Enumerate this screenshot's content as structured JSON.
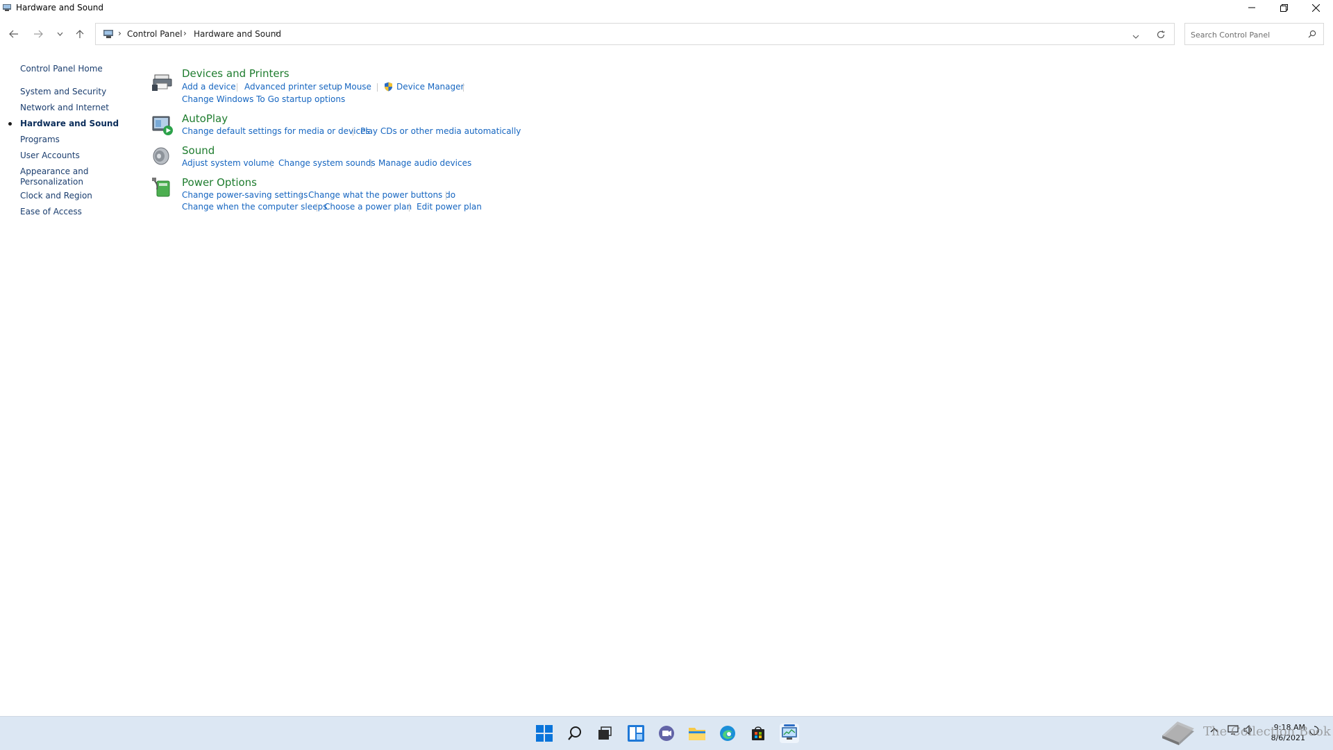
{
  "window": {
    "title": "Hardware and Sound"
  },
  "address": {
    "crumbs": [
      "Control Panel",
      "Hardware and Sound"
    ],
    "search_placeholder": "Search Control Panel"
  },
  "sidebar": {
    "items": [
      {
        "label": "Control Panel Home",
        "active": false
      },
      {
        "label": "System and Security",
        "active": false
      },
      {
        "label": "Network and Internet",
        "active": false
      },
      {
        "label": "Hardware and Sound",
        "active": true
      },
      {
        "label": "Programs",
        "active": false
      },
      {
        "label": "User Accounts",
        "active": false
      },
      {
        "label": "Appearance and Personalization",
        "active": false
      },
      {
        "label": "Clock and Region",
        "active": false
      },
      {
        "label": "Ease of Access",
        "active": false
      }
    ],
    "appearance_line1": "Appearance and",
    "appearance_line2": "Personalization"
  },
  "categories": [
    {
      "title": "Devices and Printers",
      "icon": "printer-icon",
      "links": [
        "Add a device",
        "Advanced printer setup",
        "Mouse",
        "Device Manager",
        "Change Windows To Go startup options"
      ]
    },
    {
      "title": "AutoPlay",
      "icon": "autoplay-icon",
      "links": [
        "Change default settings for media or devices",
        "Play CDs or other media automatically"
      ]
    },
    {
      "title": "Sound",
      "icon": "speaker-icon",
      "links": [
        "Adjust system volume",
        "Change system sounds",
        "Manage audio devices"
      ]
    },
    {
      "title": "Power Options",
      "icon": "power-icon",
      "links": [
        "Change power-saving settings",
        "Change what the power buttons do",
        "Change when the computer sleeps",
        "Choose a power plan",
        "Edit power plan"
      ]
    }
  ],
  "taskbar": {
    "icons": [
      "start-icon",
      "search-icon",
      "task-view-icon",
      "widgets-icon",
      "chat-icon",
      "file-explorer-icon",
      "edge-icon",
      "store-icon",
      "control-panel-icon"
    ],
    "time": "9:18 AM",
    "date": "8/6/2021"
  },
  "watermark": {
    "text": "The Collection Book"
  },
  "colors": {
    "link": "#1565c0",
    "category_title": "#1e7c2e",
    "taskbar_bg": "#dce7f3"
  }
}
